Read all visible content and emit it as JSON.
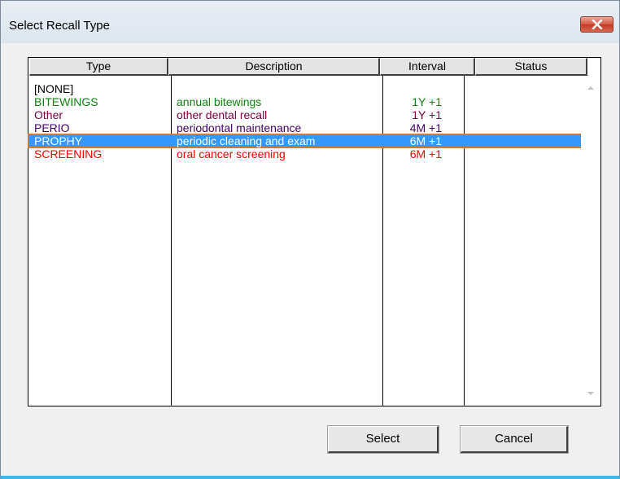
{
  "window": {
    "title": "Select Recall Type",
    "close_icon": "close-icon",
    "close_color": "#c8432e"
  },
  "table": {
    "columns": [
      "Type",
      "Description",
      "Interval",
      "Status"
    ],
    "rows": [
      {
        "type": "[NONE]",
        "description": "",
        "interval": "",
        "status": "",
        "color": "#000000",
        "selected": false
      },
      {
        "type": "BITEWINGS",
        "description": "annual bitewings",
        "interval": "1Y +1",
        "status": "",
        "color": "#108010",
        "selected": false
      },
      {
        "type": "Other",
        "description": "other dental recall",
        "interval": "1Y +1",
        "status": "",
        "color": "#800040",
        "selected": false
      },
      {
        "type": "PERIO",
        "description": "periodontal maintenance",
        "interval": "4M +1",
        "status": "",
        "color": "#40006a",
        "selected": false
      },
      {
        "type": "PROPHY",
        "description": "periodic cleaning and exam",
        "interval": "6M +1",
        "status": "",
        "color": "#0000ff",
        "selected": true
      },
      {
        "type": "SCREENING",
        "description": "oral cancer screening",
        "interval": "6M +1",
        "status": "",
        "color": "#ff0000",
        "selected": false
      }
    ],
    "selection_color": "#3399ff"
  },
  "buttons": {
    "select_label": "Select",
    "cancel_label": "Cancel"
  }
}
